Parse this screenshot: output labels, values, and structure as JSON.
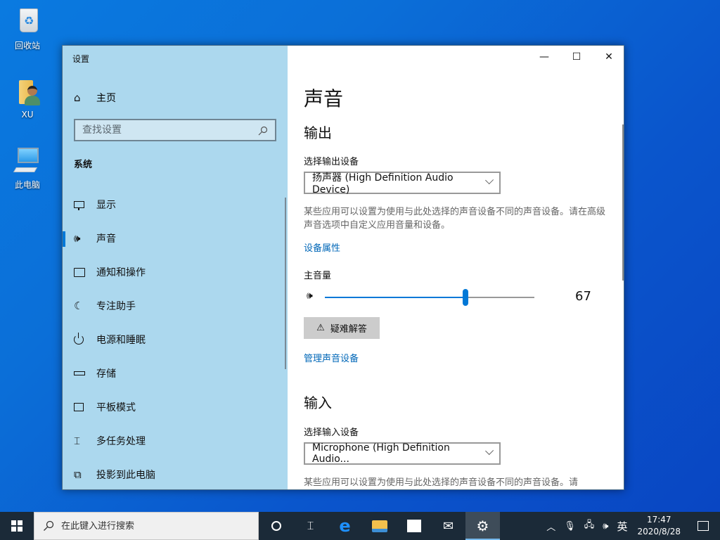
{
  "desktop": {
    "icons": [
      {
        "label": "回收站",
        "icon": "recycle-bin-icon"
      },
      {
        "label": "XU",
        "icon": "user-folder-icon"
      },
      {
        "label": "此电脑",
        "icon": "this-pc-icon"
      }
    ]
  },
  "window": {
    "app_title": "设置",
    "caption": {
      "minimize": "—",
      "maximize": "☐",
      "close": "✕"
    }
  },
  "sidebar": {
    "home_label": "主页",
    "search_placeholder": "查找设置",
    "section_label": "系统",
    "items": [
      {
        "label": "显示",
        "icon": "monitor-icon"
      },
      {
        "label": "声音",
        "icon": "speaker-icon",
        "active": true
      },
      {
        "label": "通知和操作",
        "icon": "notification-icon"
      },
      {
        "label": "专注助手",
        "icon": "moon-icon"
      },
      {
        "label": "电源和睡眠",
        "icon": "power-icon"
      },
      {
        "label": "存储",
        "icon": "storage-icon"
      },
      {
        "label": "平板模式",
        "icon": "tablet-mode-icon"
      },
      {
        "label": "多任务处理",
        "icon": "multitasking-icon"
      },
      {
        "label": "投影到此电脑",
        "icon": "projecting-icon"
      }
    ]
  },
  "content": {
    "page_title": "声音",
    "output": {
      "heading": "输出",
      "select_label": "选择输出设备",
      "selected_device": "扬声器 (High Definition Audio Device)",
      "description": "某些应用可以设置为使用与此处选择的声音设备不同的声音设备。请在高级声音选项中自定义应用音量和设备。",
      "device_properties_link": "设备属性",
      "master_volume_label": "主音量",
      "volume_value": 67,
      "volume_display": "67",
      "troubleshoot_label": "疑难解答",
      "manage_devices_link": "管理声音设备"
    },
    "input": {
      "heading": "输入",
      "select_label": "选择输入设备",
      "selected_device": "Microphone (High Definition Audio...",
      "description": "某些应用可以设置为使用与此处选择的声音设备不同的声音设备。请"
    }
  },
  "taskbar": {
    "search_placeholder": "在此键入进行搜索",
    "pinned": [
      {
        "name": "task-view",
        "icon": "cortana-icon"
      },
      {
        "name": "task-view",
        "icon": "task-view-icon"
      },
      {
        "name": "edge",
        "icon": "edge-icon"
      },
      {
        "name": "file-explorer",
        "icon": "folder-icon"
      },
      {
        "name": "store",
        "icon": "store-icon"
      },
      {
        "name": "mail",
        "icon": "mail-icon"
      },
      {
        "name": "settings",
        "icon": "gear-icon",
        "active": true
      }
    ],
    "tray": {
      "ime": "英",
      "time": "17:47",
      "date": "2020/8/28"
    }
  },
  "colors": {
    "accent": "#0078d7",
    "link": "#0067b8",
    "sidebar_bg": "#acd8ee",
    "taskbar_bg": "#1b2a38"
  }
}
